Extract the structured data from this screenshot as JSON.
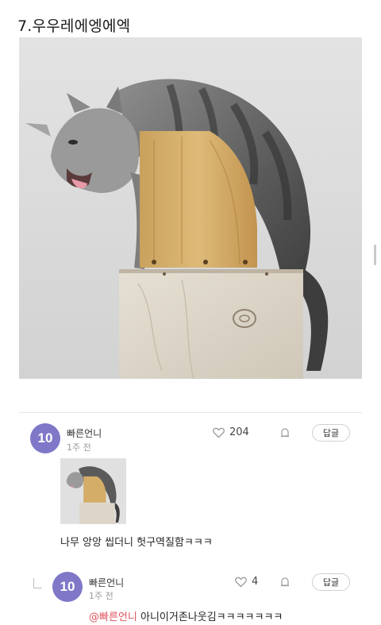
{
  "post": {
    "title": "7.우우레에엥에엑"
  },
  "comments": [
    {
      "avatar_text": "10",
      "author": "빠른언니",
      "time": "1주 전",
      "likes": "204",
      "reply_label": "답글",
      "has_image": true,
      "text": "나무 앙앙 씹더니 헛구역질함ㅋㅋㅋ"
    },
    {
      "avatar_text": "10",
      "author": "빠른언니",
      "time": "1주 전",
      "likes": "4",
      "reply_label": "답글",
      "mention": "@빠른언니",
      "text": "아니이거존나웃김ㅋㅋㅋㅋㅋㅋㅋ"
    }
  ],
  "icons": {
    "like": "heart-icon",
    "report": "bell-icon"
  },
  "colors": {
    "avatar": "#7f78c8",
    "mention": "#e0535d"
  }
}
